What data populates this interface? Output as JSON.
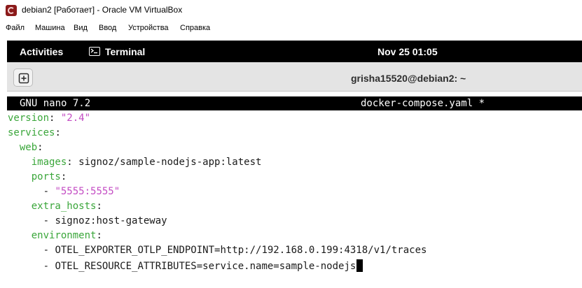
{
  "window": {
    "title": "debian2 [Работает] - Oracle VM VirtualBox"
  },
  "menubar": {
    "items": [
      "Файл",
      "Машина",
      "Вид",
      "Ввод",
      "Устройства",
      "Справка"
    ]
  },
  "gnome_topbar": {
    "activities": "Activities",
    "app_menu": "Terminal",
    "clock": "Nov 25  01:05"
  },
  "terminal": {
    "title": "grisha15520@debian2: ~"
  },
  "nano": {
    "version": "GNU nano 7.2",
    "filename": "docker-compose.yaml *"
  },
  "yaml": {
    "version_key": "version",
    "version_value": "\"2.4\"",
    "services_key": "services",
    "web_key": "web",
    "images_key": "images",
    "images_value": "signoz/sample-nodejs-app:latest",
    "ports_key": "ports",
    "port_value": "\"5555:5555\"",
    "extra_hosts_key": "extra_hosts",
    "extra_host_value": "signoz:host-gateway",
    "environment_key": "environment",
    "env_1": "OTEL_EXPORTER_OTLP_ENDPOINT=http://192.168.0.199:4318/v1/traces",
    "env_2": "OTEL_RESOURCE_ATTRIBUTES=service.name=sample-nodejs"
  },
  "colors": {
    "yaml_key": "#3aa63a",
    "yaml_string": "#c34bc3",
    "topbar": "#000000"
  },
  "icons": {
    "app": "virtualbox-debian-icon",
    "terminal": "terminal-icon",
    "new_tab": "new-tab-icon"
  }
}
